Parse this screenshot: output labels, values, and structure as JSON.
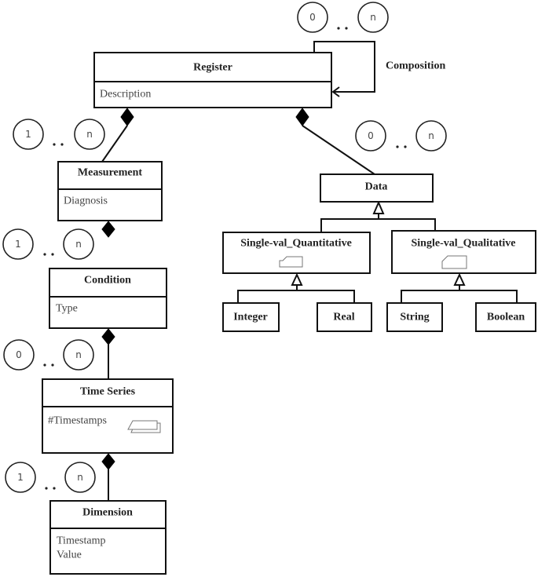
{
  "diagram": {
    "classes": {
      "register": {
        "name": "Register",
        "attributes": [
          "Description"
        ]
      },
      "measurement": {
        "name": "Measurement",
        "attributes": [
          "Diagnosis"
        ]
      },
      "condition": {
        "name": "Condition",
        "attributes": [
          "Type"
        ]
      },
      "time_series": {
        "name": "Time Series",
        "attributes": [
          "#Timestamps"
        ]
      },
      "dimension": {
        "name": "Dimension",
        "attributes": [
          "Timestamp",
          "Value"
        ]
      },
      "data": {
        "name": "Data"
      },
      "single_val_quantitative": {
        "name": "Single-val_Quantitative"
      },
      "single_val_qualitative": {
        "name": "Single-val_Qualitative"
      },
      "integer": {
        "name": "Integer"
      },
      "real": {
        "name": "Real"
      },
      "string": {
        "name": "String"
      },
      "boolean": {
        "name": "Boolean"
      }
    },
    "self_relation_label": "Composition",
    "multiplicities": {
      "composition_self": {
        "min": "0",
        "max": "n"
      },
      "register_measurement": {
        "min": "1",
        "max": "n"
      },
      "register_data": {
        "min": "0",
        "max": "n"
      },
      "measurement_condition": {
        "min": "1",
        "max": "n"
      },
      "condition_time_series": {
        "min": "0",
        "max": "n"
      },
      "time_series_dimension": {
        "min": "1",
        "max": "n"
      }
    },
    "relations": [
      {
        "type": "composition",
        "from": "Register",
        "to": "Register"
      },
      {
        "type": "composition",
        "from": "Register",
        "to": "Measurement"
      },
      {
        "type": "composition",
        "from": "Register",
        "to": "Data"
      },
      {
        "type": "composition",
        "from": "Measurement",
        "to": "Condition"
      },
      {
        "type": "composition",
        "from": "Condition",
        "to": "Time Series"
      },
      {
        "type": "composition",
        "from": "Time Series",
        "to": "Dimension"
      },
      {
        "type": "generalization",
        "parent": "Data",
        "children": [
          "Single-val_Quantitative",
          "Single-val_Qualitative"
        ]
      },
      {
        "type": "generalization",
        "parent": "Single-val_Quantitative",
        "children": [
          "Integer",
          "Real"
        ]
      },
      {
        "type": "generalization",
        "parent": "Single-val_Qualitative",
        "children": [
          "String",
          "Boolean"
        ]
      }
    ],
    "dots": ".."
  }
}
